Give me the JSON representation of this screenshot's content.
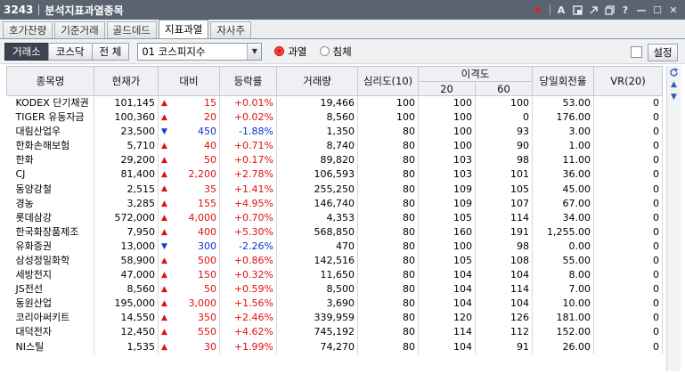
{
  "window": {
    "code": "3243",
    "title": "분석지표과열종목",
    "controls": {
      "play": "▶",
      "font": "A",
      "help": "?",
      "min": "—",
      "max": "☐",
      "close": "✕"
    }
  },
  "tabs": [
    "호가잔량",
    "기준거래",
    "골드데드",
    "지표과열",
    "자사주"
  ],
  "toolbar": {
    "market_buttons": [
      "거래소",
      "코스닥",
      "전 체"
    ],
    "index_combo": "01  코스피지수",
    "radio_overheat": "과열",
    "radio_recession": "침체",
    "settings_label": "설정"
  },
  "table": {
    "headers": {
      "name": "종목명",
      "price": "현재가",
      "diff": "대비",
      "rate": "등락률",
      "volume": "거래량",
      "psych": "심리도(10)",
      "disparity": "이격도",
      "d20": "20",
      "d60": "60",
      "turnover": "당일회전율",
      "vr": "VR(20)"
    },
    "rows": [
      {
        "name": "KODEX 단기채권",
        "price": "101,145",
        "dir": "up",
        "diff": "15",
        "rate": "+0.01%",
        "volume": "19,466",
        "psych": "100",
        "d20": "100",
        "d60": "100",
        "turnover": "53.00",
        "vr": "0"
      },
      {
        "name": "TIGER 유동자금",
        "price": "100,360",
        "dir": "up",
        "diff": "20",
        "rate": "+0.02%",
        "volume": "8,560",
        "psych": "100",
        "d20": "100",
        "d60": "0",
        "turnover": "176.00",
        "vr": "0"
      },
      {
        "name": "대림산업우",
        "price": "23,500",
        "dir": "down",
        "diff": "450",
        "rate": "-1.88%",
        "volume": "1,350",
        "psych": "80",
        "d20": "100",
        "d60": "93",
        "turnover": "3.00",
        "vr": "0"
      },
      {
        "name": "한화손해보험",
        "price": "5,710",
        "dir": "up",
        "diff": "40",
        "rate": "+0.71%",
        "volume": "8,740",
        "psych": "80",
        "d20": "100",
        "d60": "90",
        "turnover": "1.00",
        "vr": "0"
      },
      {
        "name": "한화",
        "price": "29,200",
        "dir": "up",
        "diff": "50",
        "rate": "+0.17%",
        "volume": "89,820",
        "psych": "80",
        "d20": "103",
        "d60": "98",
        "turnover": "11.00",
        "vr": "0"
      },
      {
        "name": "CJ",
        "price": "81,400",
        "dir": "up",
        "diff": "2,200",
        "rate": "+2.78%",
        "volume": "106,593",
        "psych": "80",
        "d20": "103",
        "d60": "101",
        "turnover": "36.00",
        "vr": "0"
      },
      {
        "name": "동양강철",
        "price": "2,515",
        "dir": "up",
        "diff": "35",
        "rate": "+1.41%",
        "volume": "255,250",
        "psych": "80",
        "d20": "109",
        "d60": "105",
        "turnover": "45.00",
        "vr": "0"
      },
      {
        "name": "경농",
        "price": "3,285",
        "dir": "up",
        "diff": "155",
        "rate": "+4.95%",
        "volume": "146,740",
        "psych": "80",
        "d20": "109",
        "d60": "107",
        "turnover": "67.00",
        "vr": "0"
      },
      {
        "name": "롯데삼강",
        "price": "572,000",
        "dir": "up",
        "diff": "4,000",
        "rate": "+0.70%",
        "volume": "4,353",
        "psych": "80",
        "d20": "105",
        "d60": "114",
        "turnover": "34.00",
        "vr": "0"
      },
      {
        "name": "한국화장품제조",
        "price": "7,950",
        "dir": "up",
        "diff": "400",
        "rate": "+5.30%",
        "volume": "568,850",
        "psych": "80",
        "d20": "160",
        "d60": "191",
        "turnover": "1,255.00",
        "vr": "0"
      },
      {
        "name": "유화증권",
        "price": "13,000",
        "dir": "down",
        "diff": "300",
        "rate": "-2.26%",
        "volume": "470",
        "psych": "80",
        "d20": "100",
        "d60": "98",
        "turnover": "0.00",
        "vr": "0"
      },
      {
        "name": "삼성정밀화학",
        "price": "58,900",
        "dir": "up",
        "diff": "500",
        "rate": "+0.86%",
        "volume": "142,516",
        "psych": "80",
        "d20": "105",
        "d60": "108",
        "turnover": "55.00",
        "vr": "0"
      },
      {
        "name": "세방전지",
        "price": "47,000",
        "dir": "up",
        "diff": "150",
        "rate": "+0.32%",
        "volume": "11,650",
        "psych": "80",
        "d20": "104",
        "d60": "104",
        "turnover": "8.00",
        "vr": "0"
      },
      {
        "name": "JS전선",
        "price": "8,560",
        "dir": "up",
        "diff": "50",
        "rate": "+0.59%",
        "volume": "8,500",
        "psych": "80",
        "d20": "104",
        "d60": "114",
        "turnover": "7.00",
        "vr": "0"
      },
      {
        "name": "동원산업",
        "price": "195,000",
        "dir": "up",
        "diff": "3,000",
        "rate": "+1.56%",
        "volume": "3,690",
        "psych": "80",
        "d20": "104",
        "d60": "104",
        "turnover": "10.00",
        "vr": "0"
      },
      {
        "name": "코리아써키트",
        "price": "14,550",
        "dir": "up",
        "diff": "350",
        "rate": "+2.46%",
        "volume": "339,959",
        "psych": "80",
        "d20": "120",
        "d60": "126",
        "turnover": "181.00",
        "vr": "0"
      },
      {
        "name": "대덕전자",
        "price": "12,450",
        "dir": "up",
        "diff": "550",
        "rate": "+4.62%",
        "volume": "745,192",
        "psych": "80",
        "d20": "114",
        "d60": "112",
        "turnover": "152.00",
        "vr": "0"
      },
      {
        "name": "NI스틸",
        "price": "1,535",
        "dir": "up",
        "diff": "30",
        "rate": "+1.99%",
        "volume": "74,270",
        "psych": "80",
        "d20": "104",
        "d60": "91",
        "turnover": "26.00",
        "vr": "0"
      }
    ]
  }
}
